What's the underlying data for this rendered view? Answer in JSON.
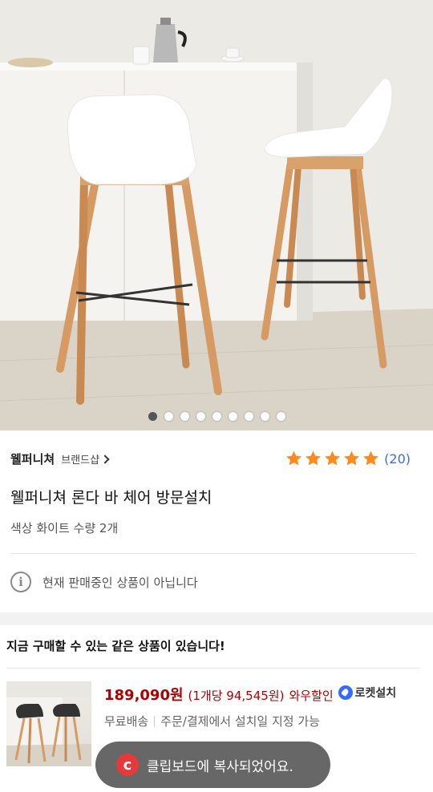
{
  "gallery": {
    "image_alt": "웰퍼니쳐 론다 바 체어 product photo",
    "dots_total": 9,
    "active_dot": 1
  },
  "brand": {
    "name": "웰퍼니쳐",
    "shop_link": "브랜드샵"
  },
  "rating": {
    "stars": 5,
    "review_count": "(20)"
  },
  "product": {
    "title": "웰퍼니쳐 론다 바 체어 방문설치",
    "options": "색상 화이트  수량 2개",
    "notice": "현재 판매중인 상품이 아닙니다"
  },
  "alternatives": {
    "heading": "지금 구매할 수 있는 같은 상품이 있습니다!",
    "items": [
      {
        "price": "189,090원",
        "unit_price": "(1개당 94,545원)",
        "discount": "와우할인",
        "badge": "로켓설치",
        "shipping": "무료배송",
        "install_note": "주문/결제에서 설치일 지정 가능"
      }
    ]
  },
  "toast": {
    "message": "클립보드에 복사되었어요."
  },
  "colors": {
    "price_red": "#ae0000",
    "link_blue": "#346aff",
    "star_orange": "#ff8a1e"
  }
}
